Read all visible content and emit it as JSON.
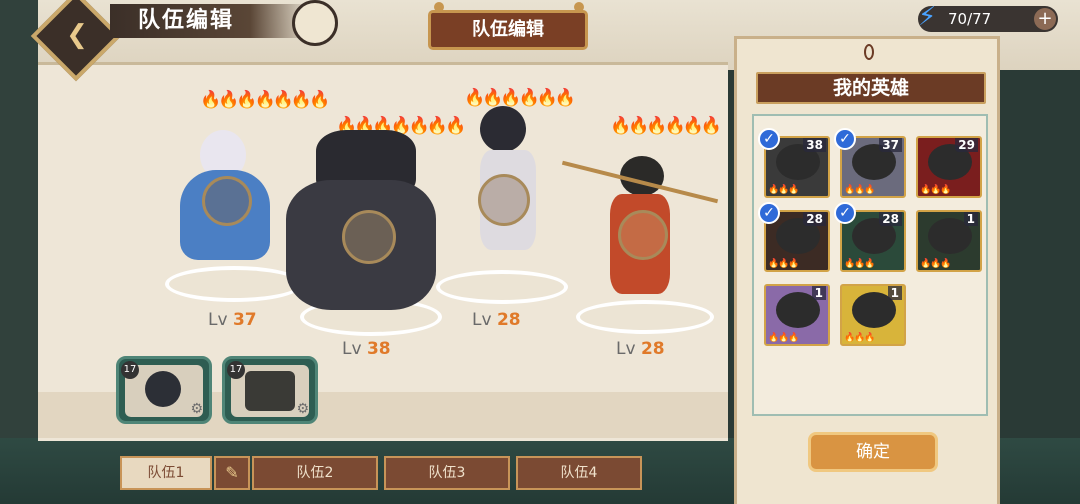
{
  "header": {
    "title": "队伍编辑",
    "sign_text": "队伍编辑",
    "energy": "70/77",
    "energy_plus": "+"
  },
  "party": [
    {
      "name": "white-hair-mage",
      "level_prefix": "Lv",
      "level": "37",
      "flame_color": "purple",
      "filled": 5,
      "total": 7
    },
    {
      "name": "dark-knight",
      "level_prefix": "Lv",
      "level": "38",
      "flame_color": "orange",
      "filled": 5,
      "total": 7
    },
    {
      "name": "dark-swordsman",
      "level_prefix": "Lv",
      "level": "28",
      "flame_color": "orange",
      "filled": 3,
      "total": 6
    },
    {
      "name": "spear-girl",
      "level_prefix": "Lv",
      "level": "28",
      "flame_color": "orange",
      "filled": 3,
      "total": 6
    }
  ],
  "reserve": [
    {
      "badge": "17"
    },
    {
      "badge": "17"
    }
  ],
  "roster": {
    "title": "我的英雄",
    "heroes": [
      {
        "level": "38",
        "selected": true,
        "bg": "#3a3a3a",
        "stars": "purple"
      },
      {
        "level": "37",
        "selected": true,
        "bg": "#6b6b7d",
        "stars": "purple"
      },
      {
        "level": "29",
        "selected": false,
        "bg": "#7a1e1e",
        "stars": "orange"
      },
      {
        "level": "28",
        "selected": true,
        "bg": "#3c2b24",
        "stars": "orange"
      },
      {
        "level": "28",
        "selected": true,
        "bg": "#2b4a3a",
        "stars": "orange"
      },
      {
        "level": "1",
        "selected": false,
        "bg": "#2c3b2e",
        "stars": "orange"
      },
      {
        "level": "1",
        "selected": false,
        "bg": "#8a6aa8",
        "stars": "orange"
      },
      {
        "level": "1",
        "selected": false,
        "bg": "#d8b43a",
        "stars": "orange"
      }
    ],
    "confirm": "确定"
  },
  "tabs": [
    "队伍1",
    "队伍2",
    "队伍3",
    "队伍4"
  ],
  "colors": {
    "accent": "#e07a2a",
    "panel": "#efe5d0",
    "tab": "#7b4a33"
  }
}
